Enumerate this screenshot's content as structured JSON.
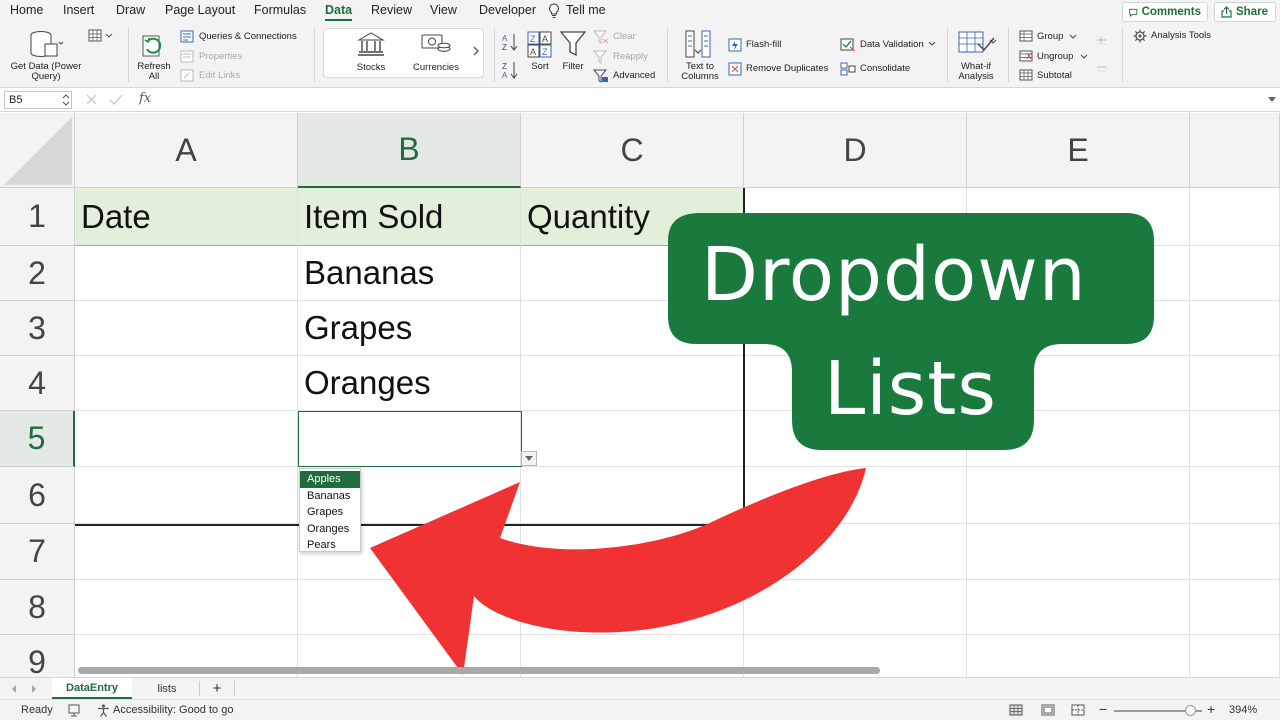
{
  "menu": {
    "tabs": [
      "Home",
      "Insert",
      "Draw",
      "Page Layout",
      "Formulas",
      "Data",
      "Review",
      "View",
      "Developer"
    ],
    "active_tab": "Data",
    "tell_me": "Tell me",
    "comments_label": "Comments",
    "share_label": "Share"
  },
  "ribbon": {
    "get_data_line1": "Get Data (Power",
    "get_data_line2": "Query)",
    "refresh_line1": "Refresh",
    "refresh_line2": "All",
    "queries_connections": "Queries & Connections",
    "properties": "Properties",
    "edit_links": "Edit Links",
    "stocks": "Stocks",
    "currencies": "Currencies",
    "sort": "Sort",
    "filter": "Filter",
    "clear": "Clear",
    "reapply": "Reapply",
    "advanced": "Advanced",
    "text_to_columns_line1": "Text to",
    "text_to_columns_line2": "Columns",
    "flash_fill": "Flash-fill",
    "remove_duplicates": "Remove Duplicates",
    "data_validation": "Data Validation",
    "consolidate": "Consolidate",
    "what_if_line1": "What-if",
    "what_if_line2": "Analysis",
    "group": "Group",
    "ungroup": "Ungroup",
    "subtotal": "Subtotal",
    "analysis_tools": "Analysis Tools"
  },
  "formula_bar": {
    "name_box": "B5",
    "fx": "fx",
    "value": ""
  },
  "sheet": {
    "columns": [
      "A",
      "B",
      "C",
      "D",
      "E"
    ],
    "rows": [
      "1",
      "2",
      "3",
      "4",
      "5",
      "6",
      "7",
      "8",
      "9"
    ],
    "selected_column": "B",
    "selected_row": "5",
    "header_row": [
      "Date",
      "Item Sold",
      "Quantity"
    ],
    "column_b_values": [
      "Bananas",
      "Grapes",
      "Oranges"
    ]
  },
  "dropdown": {
    "options": [
      "Apples",
      "Bananas",
      "Grapes",
      "Oranges",
      "Pears"
    ],
    "highlighted": "Apples"
  },
  "overlay": {
    "line1": "Dropdown",
    "line2": "Lists",
    "bubble_color": "#1a7a3e",
    "arrow_color": "#f03232"
  },
  "sheet_tabs": {
    "tabs": [
      "DataEntry",
      "lists"
    ],
    "active": "DataEntry",
    "add": "+"
  },
  "status": {
    "ready": "Ready",
    "accessibility": "Accessibility: Good to go",
    "zoom_minus": "−",
    "zoom_plus": "+",
    "zoom": "394%",
    "zoom_level": 0.86
  },
  "colors": {
    "accent": "#1e6e3c",
    "header_fill": "#e2efda"
  }
}
